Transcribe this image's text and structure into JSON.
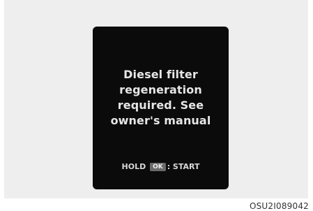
{
  "display": {
    "message": "Diesel filter\nregeneration\nrequired. See\nowner's manual",
    "hint_prefix": "HOLD",
    "ok_key": "OK",
    "hint_suffix": ": START"
  },
  "figure_code": "OSU2I089042"
}
